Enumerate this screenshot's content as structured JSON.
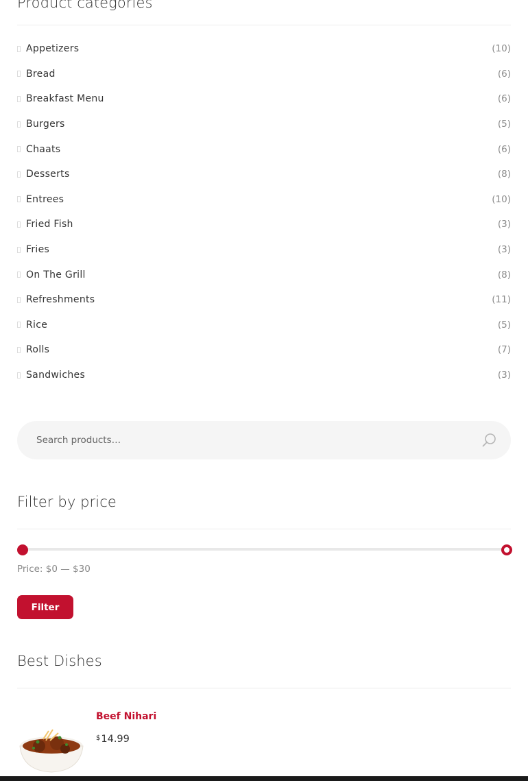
{
  "categories": {
    "title": "Product categories",
    "items": [
      {
        "label": "Appetizers",
        "count": "(10)"
      },
      {
        "label": "Bread",
        "count": "(6)"
      },
      {
        "label": "Breakfast Menu",
        "count": "(6)"
      },
      {
        "label": "Burgers",
        "count": "(5)"
      },
      {
        "label": "Chaats",
        "count": "(6)"
      },
      {
        "label": "Desserts",
        "count": "(8)"
      },
      {
        "label": "Entrees",
        "count": "(10)"
      },
      {
        "label": "Fried Fish",
        "count": "(3)"
      },
      {
        "label": "Fries",
        "count": "(3)"
      },
      {
        "label": "On The Grill",
        "count": "(8)"
      },
      {
        "label": "Refreshments",
        "count": "(11)"
      },
      {
        "label": "Rice",
        "count": "(5)"
      },
      {
        "label": "Rolls",
        "count": "(7)"
      },
      {
        "label": "Sandwiches",
        "count": "(3)"
      }
    ]
  },
  "search": {
    "placeholder": "Search products…",
    "icon": "search-icon"
  },
  "price_filter": {
    "title": "Filter by price",
    "label": "Price: $0 — $30",
    "min_value": 0,
    "max_value": 30,
    "button_label": "Filter"
  },
  "best_dishes": {
    "title": "Best Dishes",
    "items": [
      {
        "name": "Beef Nihari",
        "currency": "$",
        "price": "14.99"
      }
    ]
  },
  "colors": {
    "accent": "#c2112f",
    "text": "#333333",
    "muted": "#888888",
    "divider": "#ececec"
  }
}
